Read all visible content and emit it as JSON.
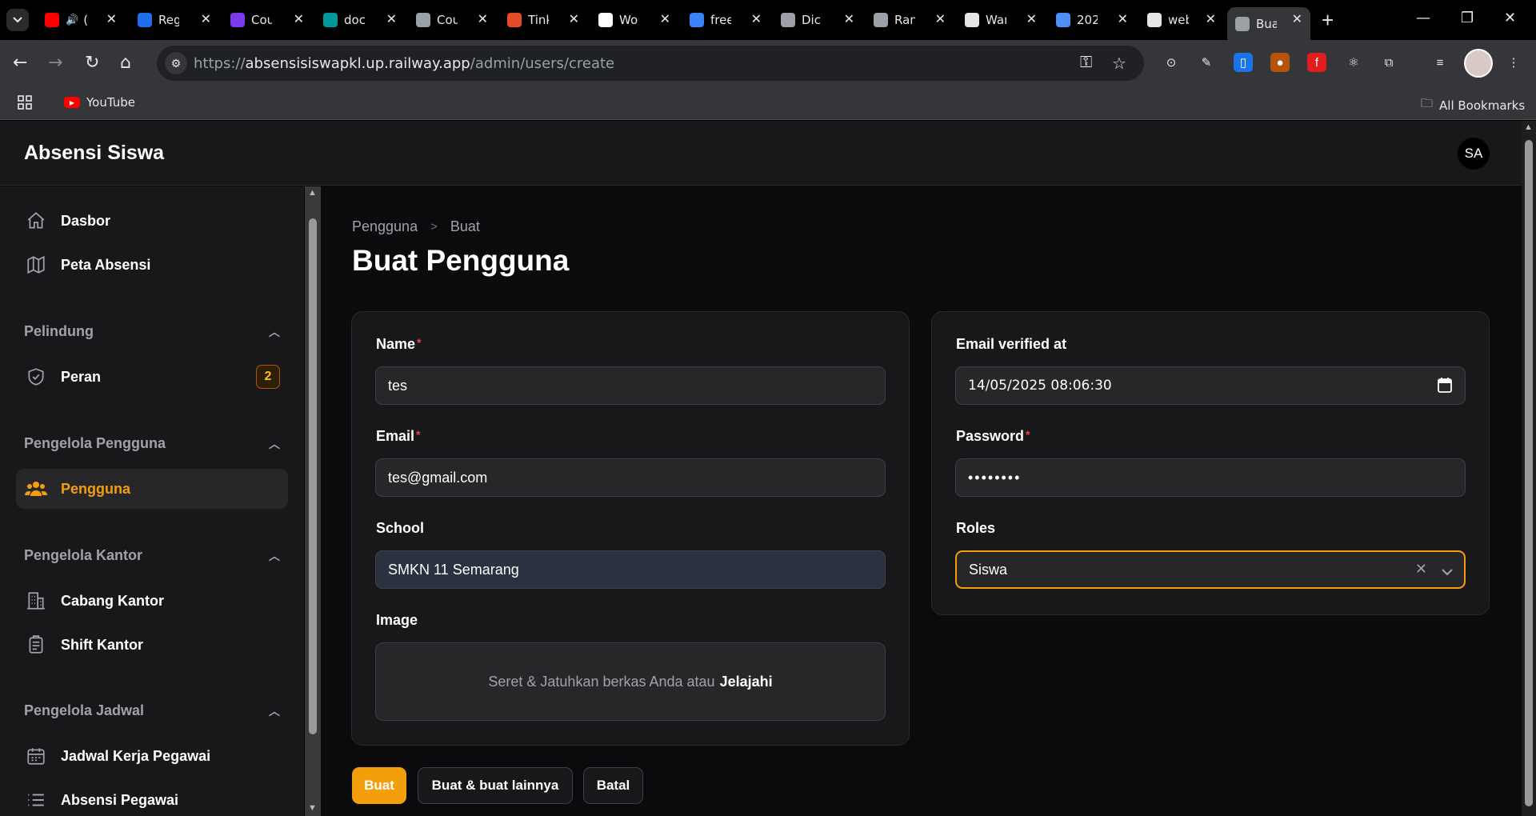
{
  "browser": {
    "tabs": [
      {
        "title": "(",
        "favicon_color": "#ff0000",
        "muted_icon": "speaker-icon"
      },
      {
        "title": "Reg",
        "favicon_color": "#1f6feb"
      },
      {
        "title": "Cou",
        "favicon_color": "#7c3aed"
      },
      {
        "title": "doc",
        "favicon_color": "#00979d"
      },
      {
        "title": "Cou",
        "favicon_color": "#9aa0a6"
      },
      {
        "title": "Tink",
        "favicon_color": "#e34c26"
      },
      {
        "title": "Wo",
        "favicon_color": "#ffffff"
      },
      {
        "title": "free",
        "favicon_color": "#3b82f6"
      },
      {
        "title": "Dic",
        "favicon_color": "#9aa0a6"
      },
      {
        "title": "Ran",
        "favicon_color": "#9aa0a6"
      },
      {
        "title": "War",
        "favicon_color": "#e5e5e5"
      },
      {
        "title": "202",
        "favicon_color": "#4f8ef7"
      },
      {
        "title": "web",
        "favicon_color": "#e5e5e5"
      },
      {
        "title": "Bua",
        "favicon_color": "#9aa0a6"
      }
    ],
    "active_tab_index": 13,
    "url_scheme": "https://",
    "url_host": "absensisiswapkl.up.railway.app",
    "url_path": "/admin/users/create",
    "bookmarks": {
      "youtube": "YouTube",
      "all": "All Bookmarks"
    }
  },
  "app": {
    "brand": "Absensi Siswa",
    "user_initials": "SA"
  },
  "sidebar": {
    "items": [
      {
        "label": "Dasbor",
        "icon": "home-icon"
      },
      {
        "label": "Peta Absensi",
        "icon": "map-icon"
      }
    ],
    "groups": [
      {
        "label": "Pelindung",
        "items": [
          {
            "label": "Peran",
            "icon": "shield-check-icon",
            "badge": "2"
          }
        ]
      },
      {
        "label": "Pengelola Pengguna",
        "items": [
          {
            "label": "Pengguna",
            "icon": "users-icon",
            "active": true
          }
        ]
      },
      {
        "label": "Pengelola Kantor",
        "items": [
          {
            "label": "Cabang Kantor",
            "icon": "building-icon"
          },
          {
            "label": "Shift Kantor",
            "icon": "clipboard-icon"
          }
        ]
      },
      {
        "label": "Pengelola Jadwal",
        "items": [
          {
            "label": "Jadwal Kerja Pegawai",
            "icon": "calendar-icon"
          },
          {
            "label": "Absensi Pegawai",
            "icon": "list-icon"
          }
        ]
      }
    ]
  },
  "breadcrumb": {
    "parent": "Pengguna",
    "current": "Buat"
  },
  "page_title": "Buat Pengguna",
  "form": {
    "name": {
      "label": "Name",
      "value": "tes",
      "required": true
    },
    "email": {
      "label": "Email",
      "value": "tes@gmail.com",
      "required": true
    },
    "school": {
      "label": "School",
      "value": "SMKN 11 Semarang"
    },
    "image": {
      "label": "Image",
      "drop_text": "Seret & Jatuhkan berkas Anda atau",
      "browse_text": "Jelajahi"
    },
    "email_verified_at": {
      "label": "Email verified at",
      "value": "14/05/2025 08:06:30"
    },
    "password": {
      "label": "Password",
      "value": "••••••••",
      "required": true
    },
    "roles": {
      "label": "Roles",
      "value": "Siswa"
    }
  },
  "actions": {
    "create": "Buat",
    "create_another": "Buat & buat lainnya",
    "cancel": "Batal"
  },
  "colors": {
    "accent": "#f59e0b",
    "required": "#ef4444",
    "surface": "#18181b",
    "background": "#0b0b0d"
  }
}
